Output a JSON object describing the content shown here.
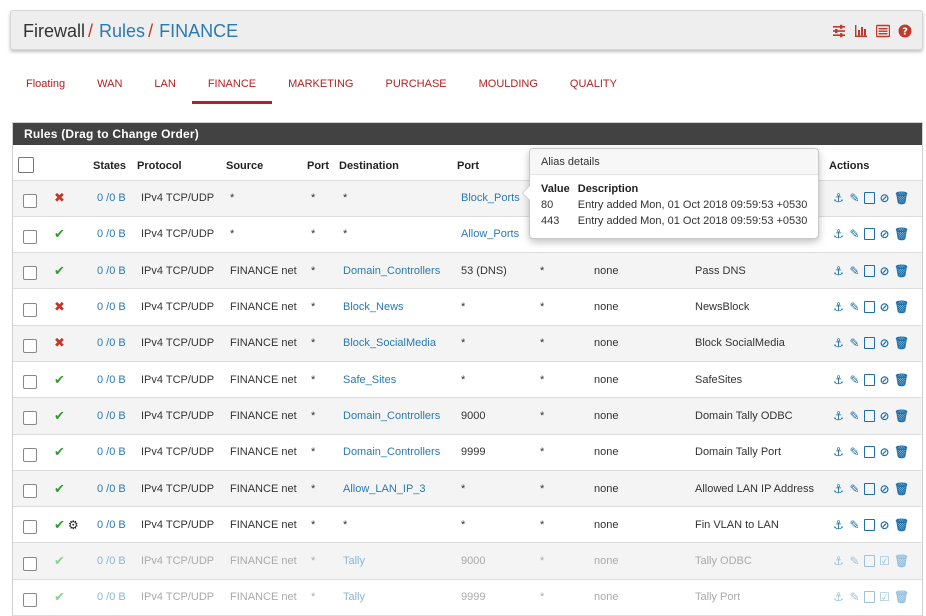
{
  "breadcrumb": {
    "root": "Firewall",
    "sep": "/",
    "rules": "Rules",
    "current": "FINANCE"
  },
  "top_icons": [
    "sliders-icon",
    "bar-chart-icon",
    "list-icon",
    "help-icon"
  ],
  "tabs": [
    {
      "label": "Floating",
      "active": false
    },
    {
      "label": "WAN",
      "active": false
    },
    {
      "label": "LAN",
      "active": false
    },
    {
      "label": "FINANCE",
      "active": true
    },
    {
      "label": "MARKETING",
      "active": false
    },
    {
      "label": "PURCHASE",
      "active": false
    },
    {
      "label": "MOULDING",
      "active": false
    },
    {
      "label": "QUALITY",
      "active": false
    }
  ],
  "panel": {
    "title": "Rules (Drag to Change Order)"
  },
  "columns": {
    "states": "States",
    "protocol": "Protocol",
    "source": "Source",
    "port": "Port",
    "destination": "Destination",
    "dport": "Port",
    "actions": "Actions"
  },
  "rules": [
    {
      "action": "block",
      "states": "0 /0 B",
      "protocol": "IPv4 TCP/UDP",
      "source": "*",
      "sport": "*",
      "destination": "*",
      "dport": "Block_Ports",
      "gateway": "",
      "queue": "",
      "description": "",
      "disabled": false,
      "dest_link": false,
      "dport_link": true
    },
    {
      "action": "pass",
      "states": "0 /0 B",
      "protocol": "IPv4 TCP/UDP",
      "source": "*",
      "sport": "*",
      "destination": "*",
      "dport": "Allow_Ports",
      "gateway": "",
      "queue": "",
      "description": "",
      "disabled": false,
      "dest_link": false,
      "dport_link": true
    },
    {
      "action": "pass",
      "states": "0 /0 B",
      "protocol": "IPv4 TCP/UDP",
      "source": "FINANCE net",
      "sport": "*",
      "destination": "Domain_Controllers",
      "dport": "53 (DNS)",
      "gateway": "*",
      "queue": "none",
      "description": "Pass DNS",
      "disabled": false,
      "dest_link": true,
      "dport_link": false
    },
    {
      "action": "block",
      "states": "0 /0 B",
      "protocol": "IPv4 TCP/UDP",
      "source": "FINANCE net",
      "sport": "*",
      "destination": "Block_News",
      "dport": "*",
      "gateway": "*",
      "queue": "none",
      "description": "NewsBlock",
      "disabled": false,
      "dest_link": true,
      "dport_link": false
    },
    {
      "action": "block",
      "states": "0 /0 B",
      "protocol": "IPv4 TCP/UDP",
      "source": "FINANCE net",
      "sport": "*",
      "destination": "Block_SocialMedia",
      "dport": "*",
      "gateway": "*",
      "queue": "none",
      "description": "Block SocialMedia",
      "disabled": false,
      "dest_link": true,
      "dport_link": false
    },
    {
      "action": "pass",
      "states": "0 /0 B",
      "protocol": "IPv4 TCP/UDP",
      "source": "FINANCE net",
      "sport": "*",
      "destination": "Safe_Sites",
      "dport": "*",
      "gateway": "*",
      "queue": "none",
      "description": "SafeSites",
      "disabled": false,
      "dest_link": true,
      "dport_link": false
    },
    {
      "action": "pass",
      "states": "0 /0 B",
      "protocol": "IPv4 TCP/UDP",
      "source": "FINANCE net",
      "sport": "*",
      "destination": "Domain_Controllers",
      "dport": "9000",
      "gateway": "*",
      "queue": "none",
      "description": "Domain Tally ODBC",
      "disabled": false,
      "dest_link": true,
      "dport_link": false
    },
    {
      "action": "pass",
      "states": "0 /0 B",
      "protocol": "IPv4 TCP/UDP",
      "source": "FINANCE net",
      "sport": "*",
      "destination": "Domain_Controllers",
      "dport": "9999",
      "gateway": "*",
      "queue": "none",
      "description": "Domain Tally Port",
      "disabled": false,
      "dest_link": true,
      "dport_link": false
    },
    {
      "action": "pass",
      "states": "0 /0 B",
      "protocol": "IPv4 TCP/UDP",
      "source": "FINANCE net",
      "sport": "*",
      "destination": "Allow_LAN_IP_3",
      "dport": "*",
      "gateway": "*",
      "queue": "none",
      "description": "Allowed LAN IP Address",
      "disabled": false,
      "dest_link": true,
      "dport_link": false
    },
    {
      "action": "pass",
      "states": "0 /0 B",
      "protocol": "IPv4 TCP/UDP",
      "source": "FINANCE net",
      "sport": "*",
      "destination": "*",
      "dport": "*",
      "gateway": "*",
      "queue": "none",
      "description": "Fin VLAN to LAN",
      "disabled": false,
      "dest_link": false,
      "dport_link": false,
      "gear": true
    },
    {
      "action": "pass",
      "states": "0 /0 B",
      "protocol": "IPv4 TCP/UDP",
      "source": "FINANCE net",
      "sport": "*",
      "destination": "Tally",
      "dport": "9000",
      "gateway": "*",
      "queue": "none",
      "description": "Tally ODBC",
      "disabled": true,
      "dest_link": true,
      "dport_link": false
    },
    {
      "action": "pass",
      "states": "0 /0 B",
      "protocol": "IPv4 TCP/UDP",
      "source": "FINANCE net",
      "sport": "*",
      "destination": "Tally",
      "dport": "9999",
      "gateway": "*",
      "queue": "none",
      "description": "Tally Port",
      "disabled": true,
      "dest_link": true,
      "dport_link": false
    }
  ],
  "popover": {
    "title": "Alias details",
    "col_value": "Value",
    "col_desc": "Description",
    "entries": [
      {
        "value": "80",
        "description": "Entry added Mon, 01 Oct 2018 09:59:53 +0530"
      },
      {
        "value": "443",
        "description": "Entry added Mon, 01 Oct 2018 09:59:53 +0530"
      }
    ]
  },
  "colors": {
    "accent": "#b22222",
    "link": "#2a7ab0",
    "pass": "#2e9d2e",
    "block": "#c0392b",
    "action_icon": "#1f6fa8"
  }
}
